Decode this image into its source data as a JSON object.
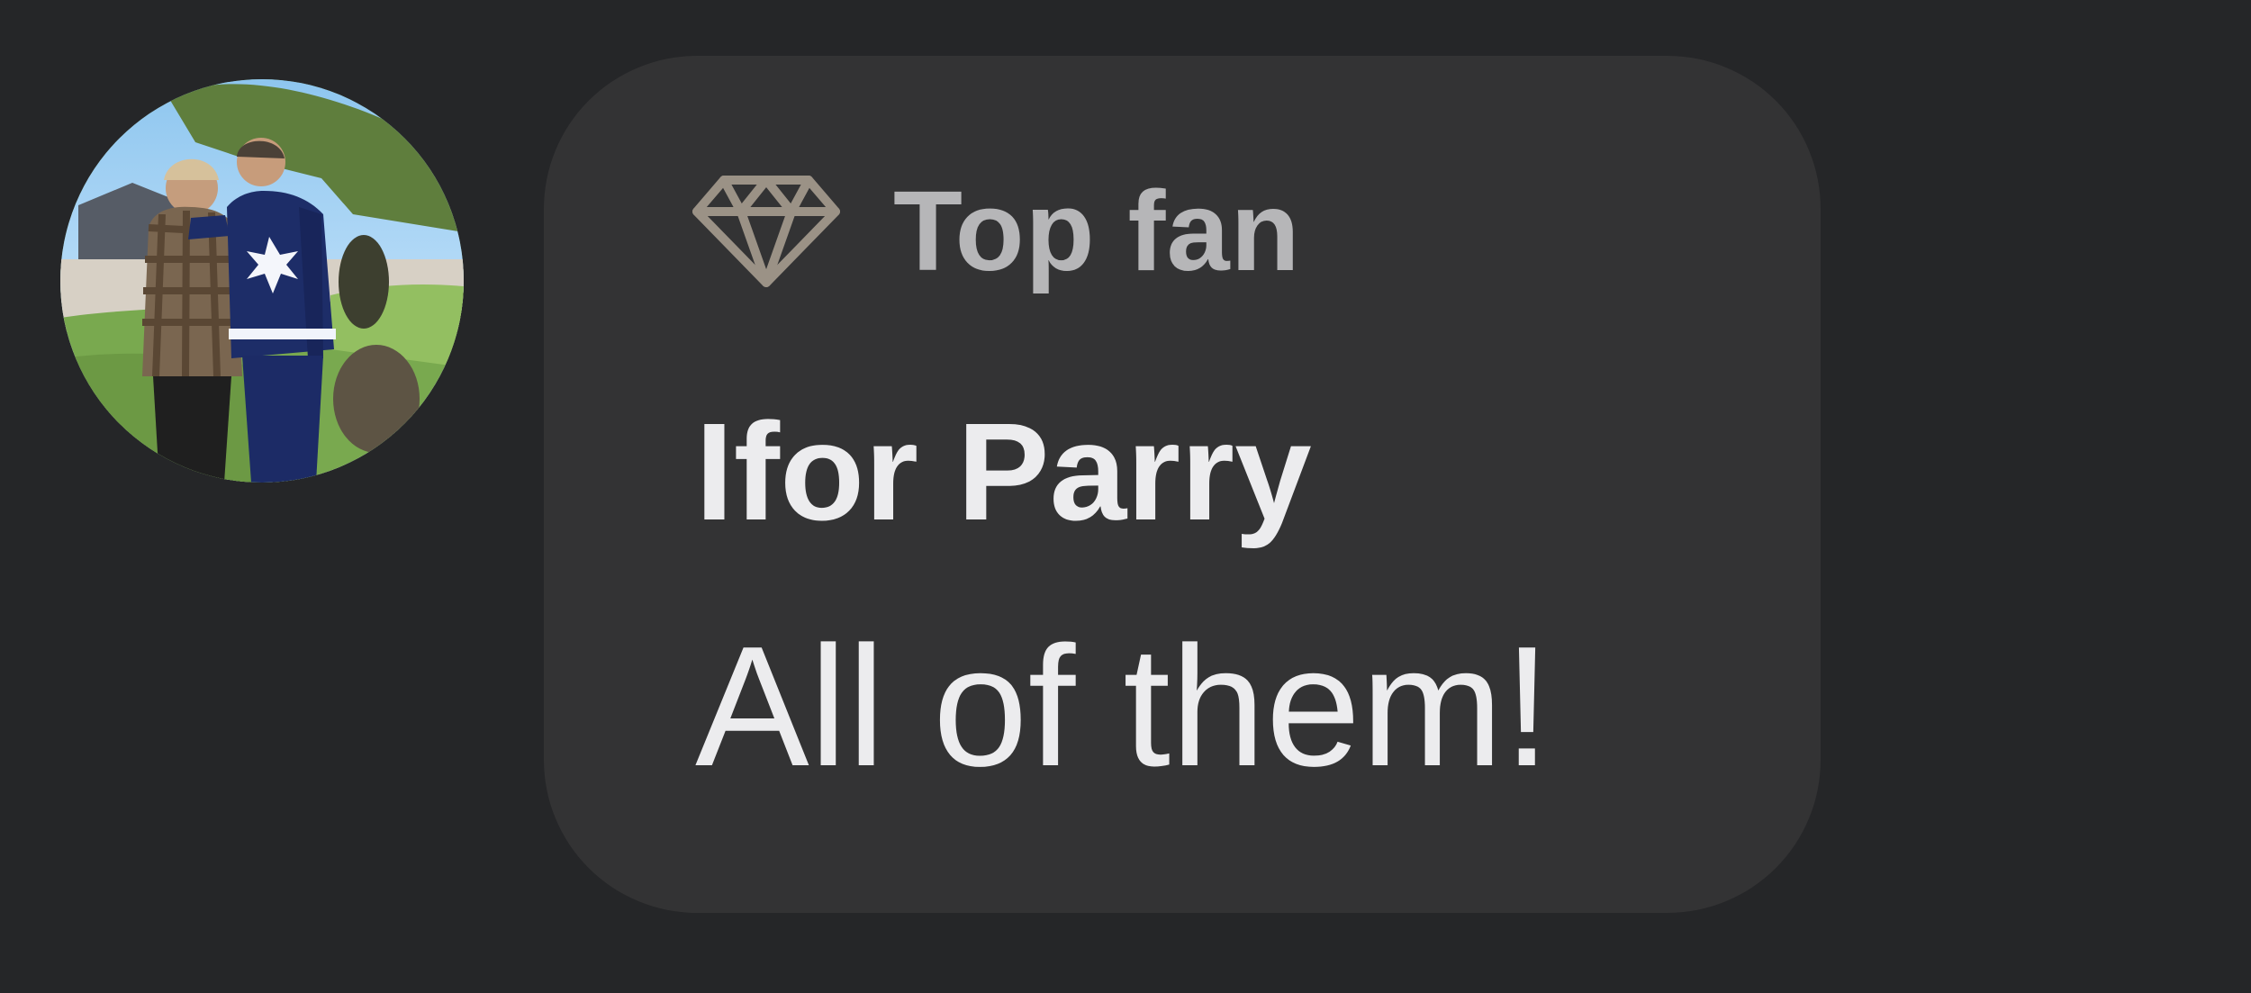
{
  "comment": {
    "badge_icon": "diamond-icon",
    "badge_label": "Top fan",
    "author_name": "Ifor Parry",
    "text": "All of them!"
  },
  "colors": {
    "page_background": "#252628",
    "bubble_background": "#333334",
    "badge_icon": "#9b9286",
    "badge_text": "#b6b6b8",
    "author_text": "#ececee",
    "comment_text": "#ececee"
  }
}
